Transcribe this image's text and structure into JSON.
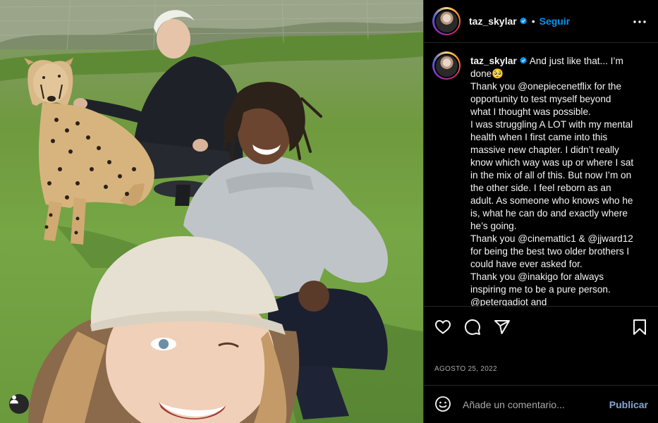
{
  "photo": {
    "alt_icon": "user-tag-icon"
  },
  "header": {
    "username": "taz_skylar",
    "verified_icon": "verified-badge-icon",
    "separator": "•",
    "follow_label": "Seguir",
    "more_icon": "more-options-icon"
  },
  "caption": {
    "username": "taz_skylar",
    "lines": [
      "And just like that... I’m",
      "done🥺",
      "Thank you @onepiecenetflix for the",
      "opportunity to test myself beyond",
      "what I thought was possible.",
      "I was struggling A LOT with my mental",
      "health when I first came into this",
      "massive new chapter. I didn’t really",
      "know which way was up or where I sat",
      "in the mix of all of this. But now I’m on",
      "the other side. I feel reborn as an",
      "adult. As someone who knows who he",
      "is, what he can do and exactly where",
      "he’s going.",
      "Thank you @cinemattic1 & @jjward12",
      "for being the best two older brothers I",
      "could have ever asked for.",
      "Thank you @inakigo for always",
      "inspiring me to be a pure person.",
      "@petergadiot and"
    ]
  },
  "actions": {
    "like_icon": "heart-icon",
    "comment_icon": "comment-icon",
    "share_icon": "send-icon",
    "save_icon": "bookmark-icon",
    "date": "AGOSTO 25, 2022"
  },
  "comment": {
    "emoji_icon": "emoji-icon",
    "placeholder": "Añade un comentario...",
    "publish_label": "Publicar"
  },
  "colors": {
    "background": "#000000",
    "accent": "#0095f6",
    "publish_disabled": "#85a8d6",
    "muted": "#a8a8a8",
    "divider": "#262626"
  }
}
